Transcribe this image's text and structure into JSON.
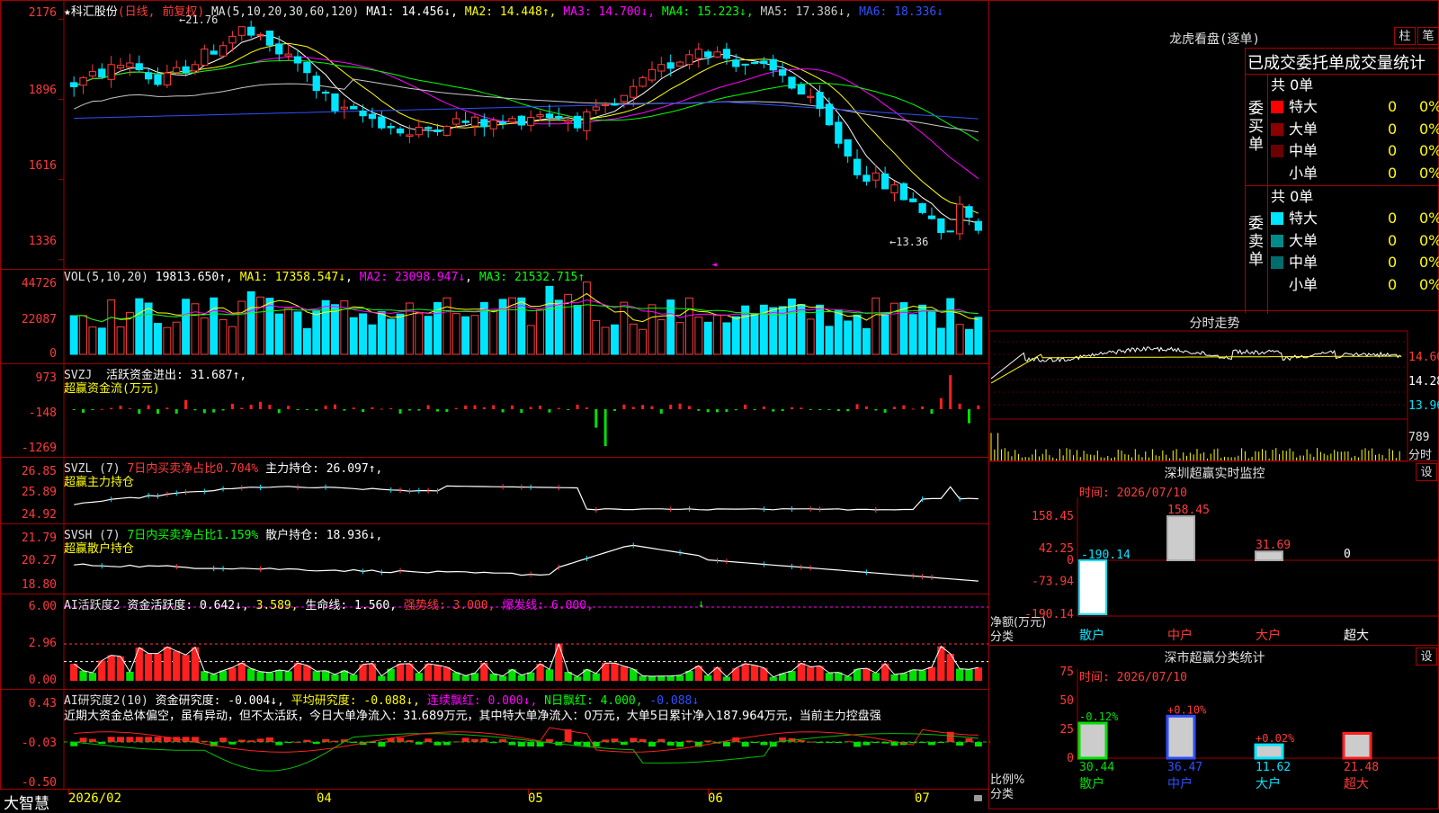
{
  "stock": {
    "star": "★",
    "name": "科汇股份",
    "mode": "(日线, 前复权)"
  },
  "main": {
    "ma_spec": "MA(5,10,20,30,60,120)",
    "mas": [
      {
        "label": "MA1: 14.456↓",
        "color": "#ffffff"
      },
      {
        "label": "MA2: 14.448↑",
        "color": "#ffff00"
      },
      {
        "label": "MA3: 14.700↓",
        "color": "#ff00ff"
      },
      {
        "label": "MA4: 15.223↓",
        "color": "#00ff00"
      },
      {
        "label": "MA5: 17.386↓",
        "color": "#c8c8c8"
      },
      {
        "label": "MA6: 18.336↓",
        "color": "#3050ff"
      }
    ],
    "y_ticks": [
      "2176",
      "1896",
      "1616",
      "1336"
    ],
    "high_label": "21.76",
    "low_label": "13.36"
  },
  "vol": {
    "label": "VOL(5,10,20)",
    "value": "19813.650↑",
    "ma1": "MA1: 17358.547↓",
    "ma2": "MA2: 23098.947↓",
    "ma3": "MA3: 21532.715↑",
    "y_ticks": [
      "44726",
      "22087",
      "0"
    ]
  },
  "svzj": {
    "line1a": "SVZJ",
    "line1b": "活跃资金进出: 31.687↑,",
    "line2": "超赢资金流(万元)",
    "y_ticks": [
      "973",
      "-148",
      "-1269"
    ]
  },
  "svzl": {
    "l1": "SVZL (7)",
    "l2": "7日内买卖净占比0.704%",
    "l3": "主力持仓: 26.097↑,",
    "line2": "超赢主力持仓",
    "y_ticks": [
      "26.85",
      "25.89",
      "24.92"
    ]
  },
  "svsh": {
    "l1": "SVSH (7)",
    "l2": "7日内买卖净占比1.159%",
    "l3": "散户持仓: 18.936↓,",
    "line2": "超赢散户持仓",
    "y_ticks": [
      "21.79",
      "20.27",
      "18.80"
    ]
  },
  "ai1": {
    "l1": "AI活跃度2",
    "l2": "资金活跃度: 0.642↓,",
    "l3": "3.589,",
    "l4": "生命线: 1.560,",
    "l5": "强势线: 3.000,",
    "l6": "爆发线: 6.000,",
    "y_ticks": [
      "6.00",
      "2.96",
      "0.00"
    ]
  },
  "ai2": {
    "l1": "AI研究度2(10)",
    "l2": "资金研究度: -0.004↓,",
    "l3": "平均研究度: -0.088↓,",
    "l4": "连续飘红: 0.000↓,",
    "l5": "N日飘红: 4.000,",
    "l6": "-0.088↓",
    "comment": "近期大资金总体偏空，虽有异动，但不太活跃，今日大单净流入：31.689万元，其中特大单净流入：0万元，大单5日累计净入187.964万元，当前主力控盘强",
    "y_ticks": [
      "0.43",
      "-0.03",
      "-0.50"
    ]
  },
  "xaxis": {
    "brand": "大智慧",
    "labels": [
      "2026/02",
      "04",
      "05",
      "06",
      "07"
    ]
  },
  "lhb": {
    "title": "龙虎看盘(逐单)",
    "btn_bar": "柱",
    "btn_pen": "笔",
    "header": "已成交委托单成交量统计",
    "buy": {
      "side": "委买单",
      "total": "共 0单",
      "rows": [
        {
          "name": "特大",
          "color": "#ff0000",
          "count": "0",
          "pct": "0%"
        },
        {
          "name": "大单",
          "color": "#8b0000",
          "count": "0",
          "pct": "0%"
        },
        {
          "name": "中单",
          "color": "#6b0000",
          "count": "0",
          "pct": "0%"
        },
        {
          "name": "小单",
          "color": "#000000",
          "count": "0",
          "pct": "0%"
        }
      ]
    },
    "sell": {
      "side": "委卖单",
      "total": "共 0单",
      "rows": [
        {
          "name": "特大",
          "color": "#00e5ff",
          "count": "0",
          "pct": "0%"
        },
        {
          "name": "大单",
          "color": "#008b8b",
          "count": "0",
          "pct": "0%"
        },
        {
          "name": "中单",
          "color": "#006d6d",
          "count": "0",
          "pct": "0%"
        },
        {
          "name": "小单",
          "color": "#000000",
          "count": "0",
          "pct": "0%"
        }
      ]
    }
  },
  "fenshi": {
    "title": "分时走势",
    "prices": [
      "14.60",
      "14.28",
      "13.96"
    ],
    "vol": "789",
    "vol_unit": "分时"
  },
  "sz_monitor": {
    "title": "深圳超赢实时监控",
    "btn": "设",
    "time": "时间: 2026/07/10",
    "y_ticks": [
      "158.45",
      "42.25",
      "0",
      "-73.94",
      "-190.14"
    ],
    "ylabel": "净额(万元)",
    "xlabel": "分类",
    "cats": [
      "散户",
      "中户",
      "大户",
      "超大"
    ],
    "values": [
      -190.14,
      158.45,
      31.69,
      0
    ],
    "value_labels": [
      "-190.14",
      "158.45",
      "31.69",
      "0"
    ]
  },
  "sz_class": {
    "title": "深市超赢分类统计",
    "btn": "设",
    "time": "时间: 2026/07/10",
    "y_ticks": [
      "75",
      "50",
      "25",
      "0"
    ],
    "ylabel": "比例%",
    "xlabel": "分类",
    "cats": [
      "散户",
      "中户",
      "大户",
      "超大"
    ],
    "values": [
      30.44,
      36.47,
      11.62,
      21.48
    ],
    "changes": [
      "-0.12%",
      "+0.10%",
      "+0.02%",
      ""
    ],
    "value_labels": [
      "30.44",
      "36.47",
      "11.62",
      "21.48"
    ]
  }
}
